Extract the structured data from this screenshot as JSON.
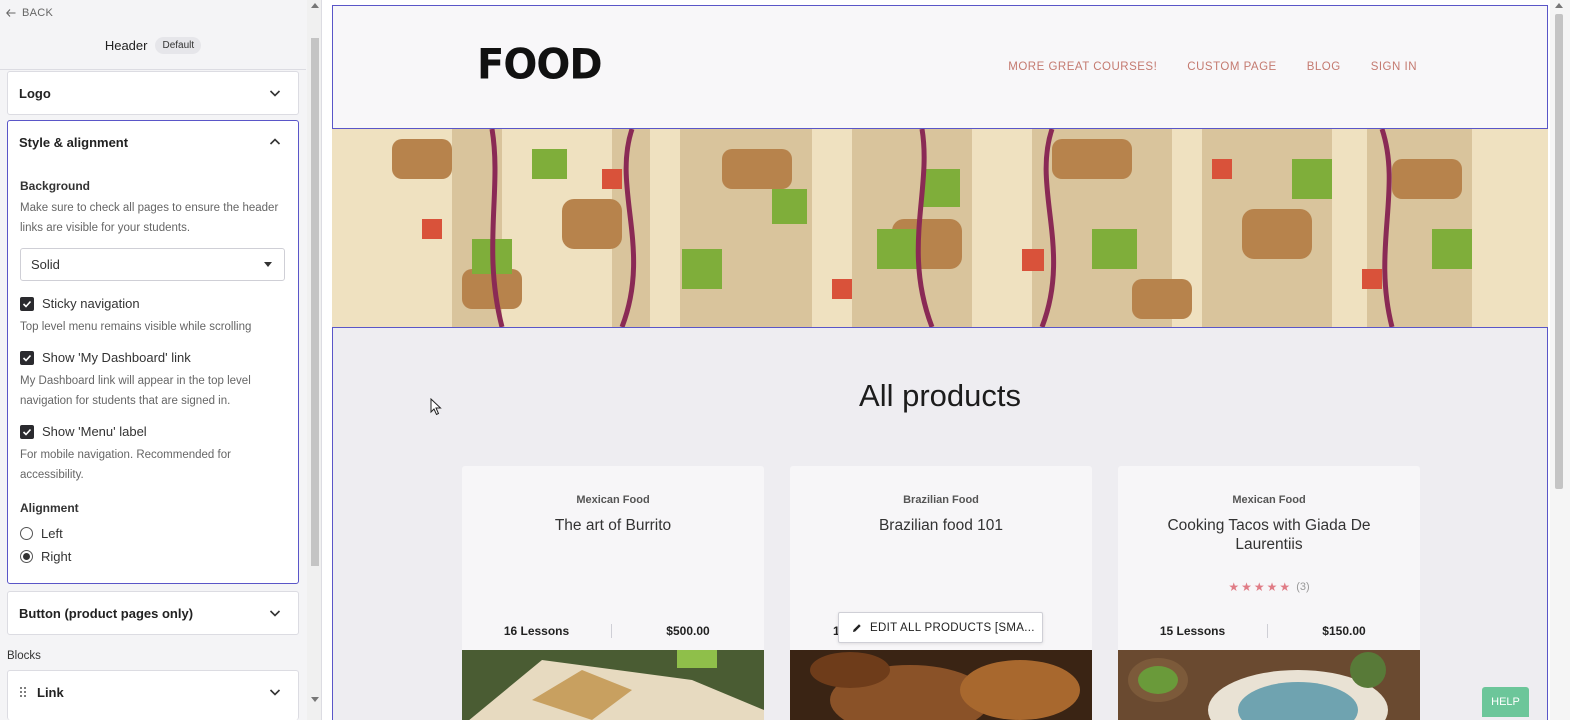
{
  "panel": {
    "back_label": "BACK",
    "title": "Header",
    "badge": "Default",
    "sections": {
      "logo": "Logo",
      "style": "Style & alignment",
      "button": "Button (product pages only)"
    },
    "background": {
      "label": "Background",
      "help": "Make sure to check all pages to ensure the header links are visible for your students.",
      "select_value": "Solid"
    },
    "sticky": {
      "label": "Sticky navigation",
      "checked": true,
      "help": "Top level menu remains visible while scrolling"
    },
    "dashboard": {
      "label": "Show 'My Dashboard' link",
      "checked": true,
      "help": "My Dashboard link will appear in the top level navigation for students that are signed in."
    },
    "menu_label": {
      "label": "Show 'Menu' label",
      "checked": true,
      "help": "For mobile navigation. Recommended for accessibility."
    },
    "alignment": {
      "label": "Alignment",
      "options": [
        {
          "label": "Left",
          "selected": false
        },
        {
          "label": "Right",
          "selected": true
        }
      ]
    },
    "blocks_label": "Blocks",
    "blocks": [
      {
        "label": "Link"
      }
    ]
  },
  "site": {
    "logo_text": "FOOD",
    "nav": [
      "MORE GREAT COURSES!",
      "CUSTOM PAGE",
      "BLOG",
      "SIGN IN"
    ],
    "products_title": "All products",
    "products": [
      {
        "category": "Mexican Food",
        "title": "The art of Burrito",
        "lessons": "16 Lessons",
        "price": "$500.00"
      },
      {
        "category": "Brazilian Food",
        "title": "Brazilian food 101",
        "lessons": "1",
        "price": ""
      },
      {
        "category": "Mexican Food",
        "title": "Cooking Tacos with Giada De Laurentiis",
        "rating_count": "(3)",
        "stars": 5,
        "lessons": "15 Lessons",
        "price": "$150.00"
      }
    ],
    "edit_button": "EDIT ALL PRODUCTS [SMA...",
    "help_button": "HELP"
  },
  "colors": {
    "accent": "#5a56c8",
    "nav_link": "#c47a70",
    "star": "#e07c86",
    "help": "#6cc69a"
  }
}
